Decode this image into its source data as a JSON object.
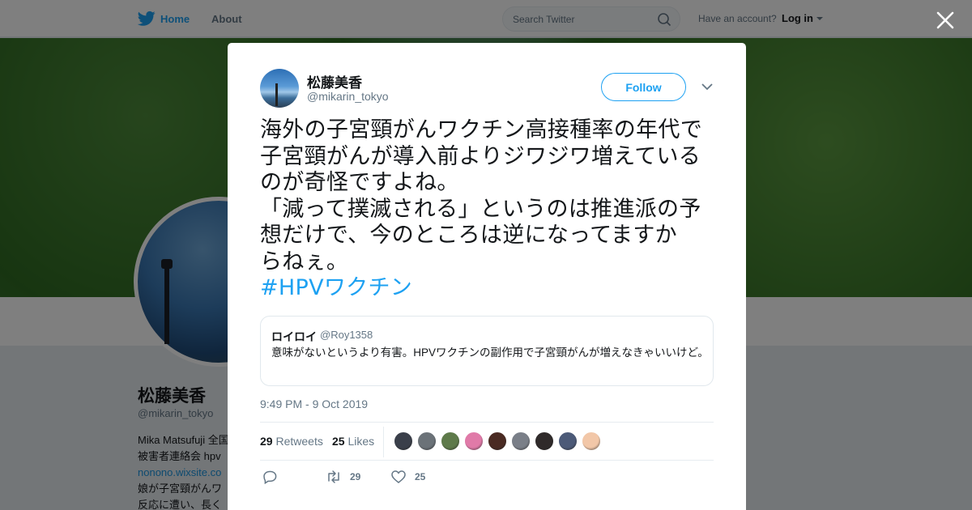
{
  "nav": {
    "home_label": "Home",
    "about_label": "About",
    "search_placeholder": "Search Twitter",
    "account_prompt": "Have an account?",
    "login_label": "Log in"
  },
  "profile": {
    "name": "松藤美香",
    "handle": "@mikarin_tokyo",
    "bio_lines": [
      "Mika Matsufuji 全国",
      "被害者連絡会 hpv",
      "nonono.wixsite.co",
      "娘が子宮頸がんワ",
      "反応に遭い、長く"
    ]
  },
  "tweet": {
    "author_name": "松藤美香",
    "author_handle": "@mikarin_tokyo",
    "follow_label": "Follow",
    "lines": [
      "海外の子宮頸がんワクチン高接種率の年代で",
      "子宮頸がんが導入前よりジワジワ増えている",
      "のが奇怪ですよね。",
      "「減って撲滅される」というのは推進派の予",
      "想だけで、今のところは逆になってますか",
      "らねぇ。"
    ],
    "hashtag": "#HPVワクチン",
    "timestamp": "9:49 PM - 9 Oct 2019",
    "retweets_count": "29",
    "retweets_label": "Retweets",
    "likes_count": "25",
    "likes_label": "Likes",
    "action_retweets": "29",
    "action_likes": "25"
  },
  "quote": {
    "name": "ロイロイ",
    "handle": "@Roy1358",
    "text": "意味がないというより有害。HPVワクチンの副作用で子宮頸がんが増えなきゃいいけど。"
  },
  "likers": [
    {
      "color": "#3a3f4a"
    },
    {
      "color": "#6b7278"
    },
    {
      "color": "#5e7a4a"
    },
    {
      "color": "#e07aa8"
    },
    {
      "color": "#4a2a22"
    },
    {
      "color": "#7a7f88"
    },
    {
      "color": "#2f2a2a"
    },
    {
      "color": "#4c5a78"
    },
    {
      "color": "#f2c7a8"
    }
  ],
  "colors": {
    "accent": "#1da1f2",
    "text": "#14171a",
    "muted": "#657786"
  }
}
